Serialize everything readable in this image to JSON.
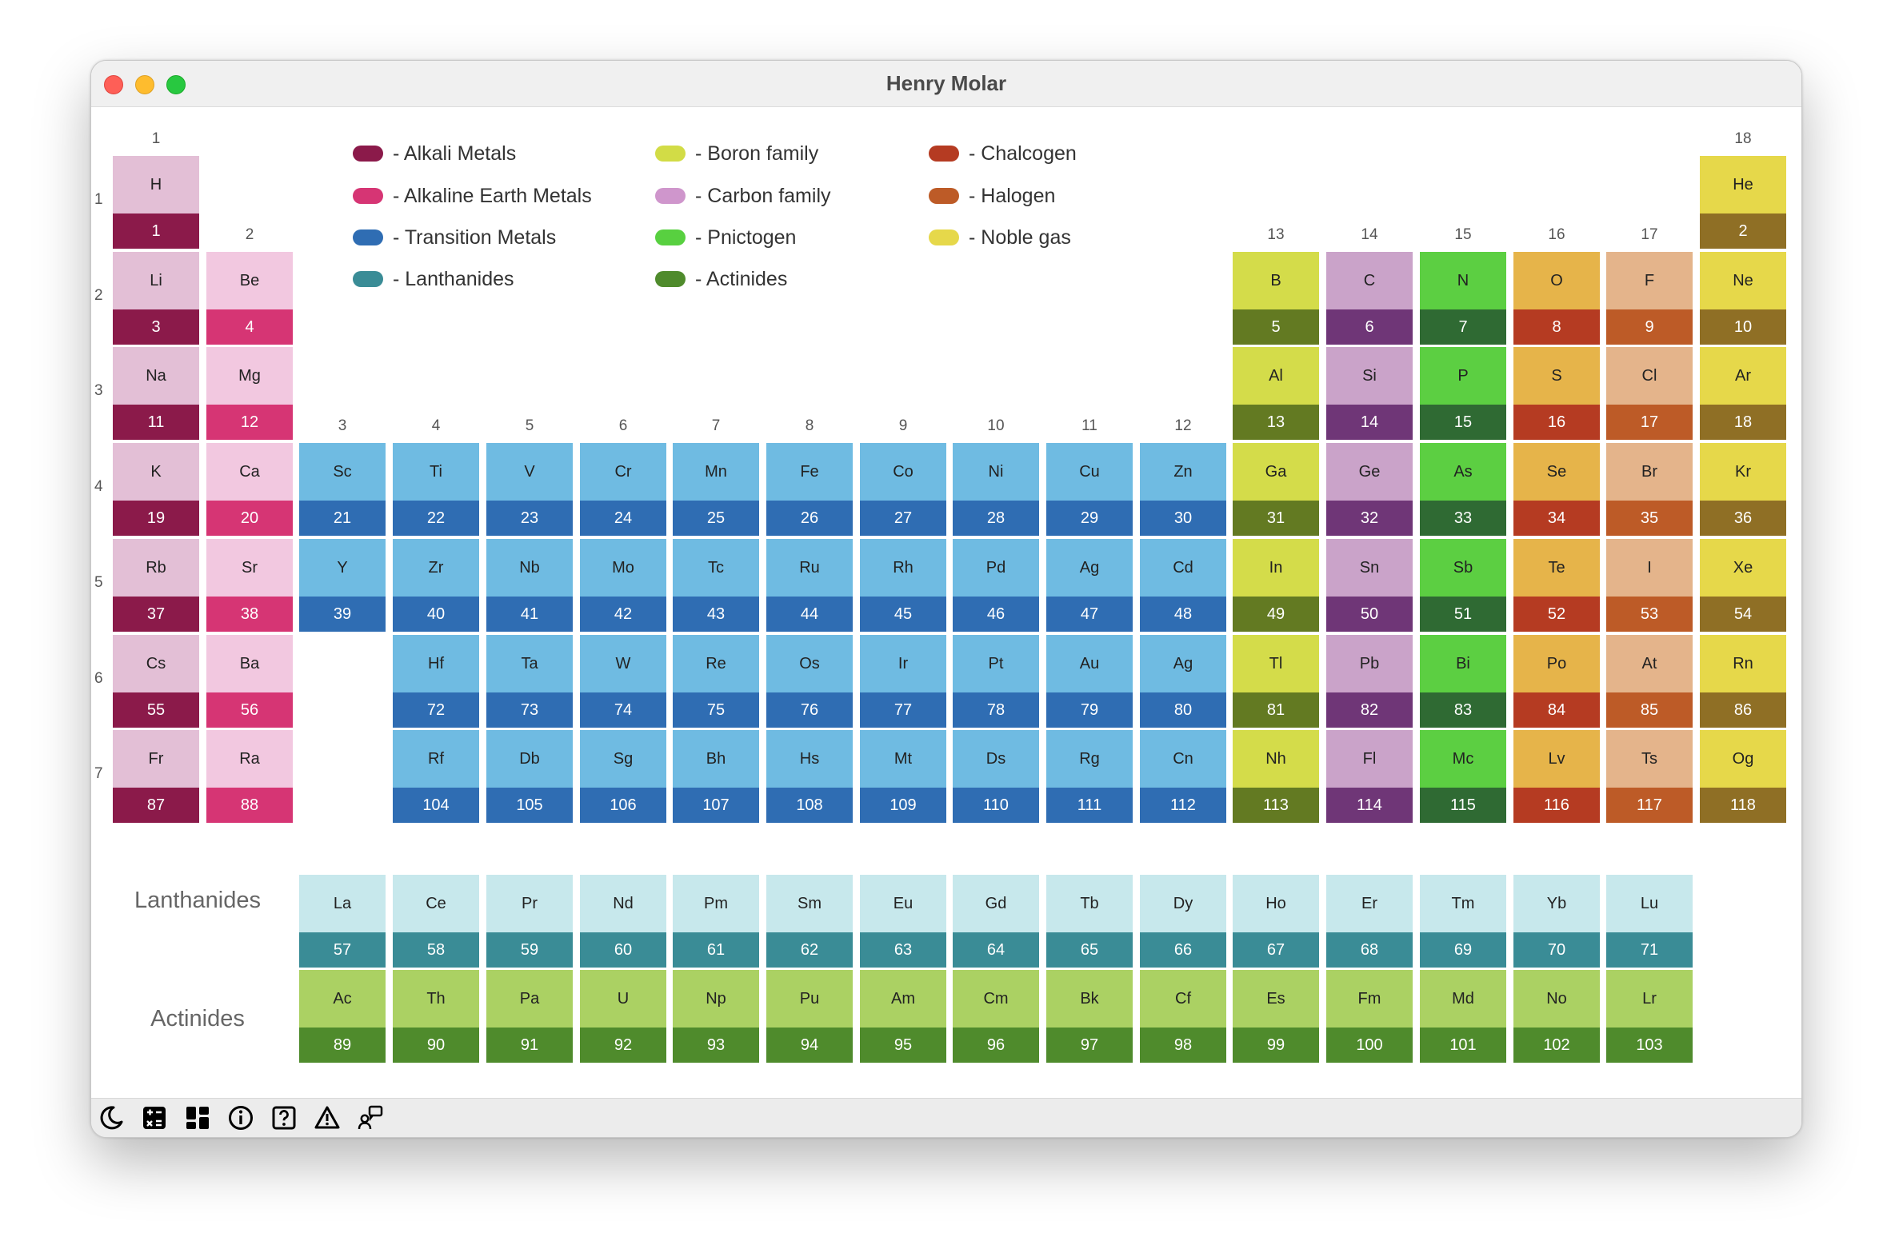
{
  "window": {
    "title": "Henry Molar"
  },
  "group_labels": [
    "1",
    "2",
    "3",
    "4",
    "5",
    "6",
    "7",
    "8",
    "9",
    "10",
    "11",
    "12",
    "13",
    "14",
    "15",
    "16",
    "17",
    "18"
  ],
  "period_labels": [
    "1",
    "2",
    "3",
    "4",
    "5",
    "6",
    "7"
  ],
  "series_labels": {
    "lanthanides": "Lanthanides",
    "actinides": "Actinides"
  },
  "legend": [
    {
      "key": "alkali",
      "label": "- Alkali Metals",
      "color": "#8b1a4a"
    },
    {
      "key": "alkaline",
      "label": "- Alkaline Earth Metals",
      "color": "#d63574"
    },
    {
      "key": "transition",
      "label": "- Transition Metals",
      "color": "#2f6db3"
    },
    {
      "key": "lanth",
      "label": "- Lanthanides",
      "color": "#3a8c96"
    },
    {
      "key": "boron",
      "label": "- Boron family",
      "color": "#d2dc46"
    },
    {
      "key": "carbon",
      "label": "- Carbon family",
      "color": "#cf96cc"
    },
    {
      "key": "pnictogen",
      "label": "- Pnictogen",
      "color": "#58d040"
    },
    {
      "key": "actin",
      "label": "- Actinides",
      "color": "#4f8b2c"
    },
    {
      "key": "chalcogen",
      "label": "- Chalcogen",
      "color": "#b53b22"
    },
    {
      "key": "halogen",
      "label": "- Halogen",
      "color": "#bd5b27"
    },
    {
      "key": "noble",
      "label": "- Noble gas",
      "color": "#e6d84a"
    }
  ],
  "categories": {
    "alkali": {
      "top": "#e3bfd6",
      "bottom": "#8b1a4a"
    },
    "alkaline": {
      "top": "#f2c8e0",
      "bottom": "#d63574"
    },
    "transition": {
      "top": "#6fbbe2",
      "bottom": "#2f6db3"
    },
    "boron": {
      "top": "#d4dc4a",
      "bottom": "#637a22"
    },
    "carbon": {
      "top": "#caa3c9",
      "bottom": "#6f3677"
    },
    "pnictogen": {
      "top": "#5ccf42",
      "bottom": "#2f6a33"
    },
    "chalcogen": {
      "top": "#e6b44a",
      "bottom": "#b53b22"
    },
    "halogen": {
      "top": "#e4b48b",
      "bottom": "#bd5b27"
    },
    "noble": {
      "top": "#e6d84a",
      "bottom": "#8f6f25"
    },
    "lanth": {
      "top": "#c7e8ec",
      "bottom": "#3a8c96"
    },
    "actin": {
      "top": "#abd163",
      "bottom": "#4f8b2c"
    }
  },
  "elements": [
    {
      "s": "H",
      "n": 1,
      "g": 1,
      "p": 1,
      "c": "alkali"
    },
    {
      "s": "He",
      "n": 2,
      "g": 18,
      "p": 1,
      "c": "noble"
    },
    {
      "s": "Li",
      "n": 3,
      "g": 1,
      "p": 2,
      "c": "alkali"
    },
    {
      "s": "Be",
      "n": 4,
      "g": 2,
      "p": 2,
      "c": "alkaline"
    },
    {
      "s": "B",
      "n": 5,
      "g": 13,
      "p": 2,
      "c": "boron"
    },
    {
      "s": "C",
      "n": 6,
      "g": 14,
      "p": 2,
      "c": "carbon"
    },
    {
      "s": "N",
      "n": 7,
      "g": 15,
      "p": 2,
      "c": "pnictogen"
    },
    {
      "s": "O",
      "n": 8,
      "g": 16,
      "p": 2,
      "c": "chalcogen"
    },
    {
      "s": "F",
      "n": 9,
      "g": 17,
      "p": 2,
      "c": "halogen"
    },
    {
      "s": "Ne",
      "n": 10,
      "g": 18,
      "p": 2,
      "c": "noble"
    },
    {
      "s": "Na",
      "n": 11,
      "g": 1,
      "p": 3,
      "c": "alkali"
    },
    {
      "s": "Mg",
      "n": 12,
      "g": 2,
      "p": 3,
      "c": "alkaline"
    },
    {
      "s": "Al",
      "n": 13,
      "g": 13,
      "p": 3,
      "c": "boron"
    },
    {
      "s": "Si",
      "n": 14,
      "g": 14,
      "p": 3,
      "c": "carbon"
    },
    {
      "s": "P",
      "n": 15,
      "g": 15,
      "p": 3,
      "c": "pnictogen"
    },
    {
      "s": "S",
      "n": 16,
      "g": 16,
      "p": 3,
      "c": "chalcogen"
    },
    {
      "s": "Cl",
      "n": 17,
      "g": 17,
      "p": 3,
      "c": "halogen"
    },
    {
      "s": "Ar",
      "n": 18,
      "g": 18,
      "p": 3,
      "c": "noble"
    },
    {
      "s": "K",
      "n": 19,
      "g": 1,
      "p": 4,
      "c": "alkali"
    },
    {
      "s": "Ca",
      "n": 20,
      "g": 2,
      "p": 4,
      "c": "alkaline"
    },
    {
      "s": "Sc",
      "n": 21,
      "g": 3,
      "p": 4,
      "c": "transition"
    },
    {
      "s": "Ti",
      "n": 22,
      "g": 4,
      "p": 4,
      "c": "transition"
    },
    {
      "s": "V",
      "n": 23,
      "g": 5,
      "p": 4,
      "c": "transition"
    },
    {
      "s": "Cr",
      "n": 24,
      "g": 6,
      "p": 4,
      "c": "transition"
    },
    {
      "s": "Mn",
      "n": 25,
      "g": 7,
      "p": 4,
      "c": "transition"
    },
    {
      "s": "Fe",
      "n": 26,
      "g": 8,
      "p": 4,
      "c": "transition"
    },
    {
      "s": "Co",
      "n": 27,
      "g": 9,
      "p": 4,
      "c": "transition"
    },
    {
      "s": "Ni",
      "n": 28,
      "g": 10,
      "p": 4,
      "c": "transition"
    },
    {
      "s": "Cu",
      "n": 29,
      "g": 11,
      "p": 4,
      "c": "transition"
    },
    {
      "s": "Zn",
      "n": 30,
      "g": 12,
      "p": 4,
      "c": "transition"
    },
    {
      "s": "Ga",
      "n": 31,
      "g": 13,
      "p": 4,
      "c": "boron"
    },
    {
      "s": "Ge",
      "n": 32,
      "g": 14,
      "p": 4,
      "c": "carbon"
    },
    {
      "s": "As",
      "n": 33,
      "g": 15,
      "p": 4,
      "c": "pnictogen"
    },
    {
      "s": "Se",
      "n": 34,
      "g": 16,
      "p": 4,
      "c": "chalcogen"
    },
    {
      "s": "Br",
      "n": 35,
      "g": 17,
      "p": 4,
      "c": "halogen"
    },
    {
      "s": "Kr",
      "n": 36,
      "g": 18,
      "p": 4,
      "c": "noble"
    },
    {
      "s": "Rb",
      "n": 37,
      "g": 1,
      "p": 5,
      "c": "alkali"
    },
    {
      "s": "Sr",
      "n": 38,
      "g": 2,
      "p": 5,
      "c": "alkaline"
    },
    {
      "s": "Y",
      "n": 39,
      "g": 3,
      "p": 5,
      "c": "transition"
    },
    {
      "s": "Zr",
      "n": 40,
      "g": 4,
      "p": 5,
      "c": "transition"
    },
    {
      "s": "Nb",
      "n": 41,
      "g": 5,
      "p": 5,
      "c": "transition"
    },
    {
      "s": "Mo",
      "n": 42,
      "g": 6,
      "p": 5,
      "c": "transition"
    },
    {
      "s": "Tc",
      "n": 43,
      "g": 7,
      "p": 5,
      "c": "transition"
    },
    {
      "s": "Ru",
      "n": 44,
      "g": 8,
      "p": 5,
      "c": "transition"
    },
    {
      "s": "Rh",
      "n": 45,
      "g": 9,
      "p": 5,
      "c": "transition"
    },
    {
      "s": "Pd",
      "n": 46,
      "g": 10,
      "p": 5,
      "c": "transition"
    },
    {
      "s": "Ag",
      "n": 47,
      "g": 11,
      "p": 5,
      "c": "transition"
    },
    {
      "s": "Cd",
      "n": 48,
      "g": 12,
      "p": 5,
      "c": "transition"
    },
    {
      "s": "In",
      "n": 49,
      "g": 13,
      "p": 5,
      "c": "boron"
    },
    {
      "s": "Sn",
      "n": 50,
      "g": 14,
      "p": 5,
      "c": "carbon"
    },
    {
      "s": "Sb",
      "n": 51,
      "g": 15,
      "p": 5,
      "c": "pnictogen"
    },
    {
      "s": "Te",
      "n": 52,
      "g": 16,
      "p": 5,
      "c": "chalcogen"
    },
    {
      "s": "I",
      "n": 53,
      "g": 17,
      "p": 5,
      "c": "halogen"
    },
    {
      "s": "Xe",
      "n": 54,
      "g": 18,
      "p": 5,
      "c": "noble"
    },
    {
      "s": "Cs",
      "n": 55,
      "g": 1,
      "p": 6,
      "c": "alkali"
    },
    {
      "s": "Ba",
      "n": 56,
      "g": 2,
      "p": 6,
      "c": "alkaline"
    },
    {
      "s": "Hf",
      "n": 72,
      "g": 4,
      "p": 6,
      "c": "transition"
    },
    {
      "s": "Ta",
      "n": 73,
      "g": 5,
      "p": 6,
      "c": "transition"
    },
    {
      "s": "W",
      "n": 74,
      "g": 6,
      "p": 6,
      "c": "transition"
    },
    {
      "s": "Re",
      "n": 75,
      "g": 7,
      "p": 6,
      "c": "transition"
    },
    {
      "s": "Os",
      "n": 76,
      "g": 8,
      "p": 6,
      "c": "transition"
    },
    {
      "s": "Ir",
      "n": 77,
      "g": 9,
      "p": 6,
      "c": "transition"
    },
    {
      "s": "Pt",
      "n": 78,
      "g": 10,
      "p": 6,
      "c": "transition"
    },
    {
      "s": "Au",
      "n": 79,
      "g": 11,
      "p": 6,
      "c": "transition"
    },
    {
      "s": "Ag",
      "n": 80,
      "g": 12,
      "p": 6,
      "c": "transition"
    },
    {
      "s": "Tl",
      "n": 81,
      "g": 13,
      "p": 6,
      "c": "boron"
    },
    {
      "s": "Pb",
      "n": 82,
      "g": 14,
      "p": 6,
      "c": "carbon"
    },
    {
      "s": "Bi",
      "n": 83,
      "g": 15,
      "p": 6,
      "c": "pnictogen"
    },
    {
      "s": "Po",
      "n": 84,
      "g": 16,
      "p": 6,
      "c": "chalcogen"
    },
    {
      "s": "At",
      "n": 85,
      "g": 17,
      "p": 6,
      "c": "halogen"
    },
    {
      "s": "Rn",
      "n": 86,
      "g": 18,
      "p": 6,
      "c": "noble"
    },
    {
      "s": "Fr",
      "n": 87,
      "g": 1,
      "p": 7,
      "c": "alkali"
    },
    {
      "s": "Ra",
      "n": 88,
      "g": 2,
      "p": 7,
      "c": "alkaline"
    },
    {
      "s": "Rf",
      "n": 104,
      "g": 4,
      "p": 7,
      "c": "transition"
    },
    {
      "s": "Db",
      "n": 105,
      "g": 5,
      "p": 7,
      "c": "transition"
    },
    {
      "s": "Sg",
      "n": 106,
      "g": 6,
      "p": 7,
      "c": "transition"
    },
    {
      "s": "Bh",
      "n": 107,
      "g": 7,
      "p": 7,
      "c": "transition"
    },
    {
      "s": "Hs",
      "n": 108,
      "g": 8,
      "p": 7,
      "c": "transition"
    },
    {
      "s": "Mt",
      "n": 109,
      "g": 9,
      "p": 7,
      "c": "transition"
    },
    {
      "s": "Ds",
      "n": 110,
      "g": 10,
      "p": 7,
      "c": "transition"
    },
    {
      "s": "Rg",
      "n": 111,
      "g": 11,
      "p": 7,
      "c": "transition"
    },
    {
      "s": "Cn",
      "n": 112,
      "g": 12,
      "p": 7,
      "c": "transition"
    },
    {
      "s": "Nh",
      "n": 113,
      "g": 13,
      "p": 7,
      "c": "boron"
    },
    {
      "s": "Fl",
      "n": 114,
      "g": 14,
      "p": 7,
      "c": "carbon"
    },
    {
      "s": "Mc",
      "n": 115,
      "g": 15,
      "p": 7,
      "c": "pnictogen"
    },
    {
      "s": "Lv",
      "n": 116,
      "g": 16,
      "p": 7,
      "c": "chalcogen"
    },
    {
      "s": "Ts",
      "n": 117,
      "g": 17,
      "p": 7,
      "c": "halogen"
    },
    {
      "s": "Og",
      "n": 118,
      "g": 18,
      "p": 7,
      "c": "noble"
    }
  ],
  "lanthanides": [
    {
      "s": "La",
      "n": 57
    },
    {
      "s": "Ce",
      "n": 58
    },
    {
      "s": "Pr",
      "n": 59
    },
    {
      "s": "Nd",
      "n": 60
    },
    {
      "s": "Pm",
      "n": 61
    },
    {
      "s": "Sm",
      "n": 62
    },
    {
      "s": "Eu",
      "n": 63
    },
    {
      "s": "Gd",
      "n": 64
    },
    {
      "s": "Tb",
      "n": 65
    },
    {
      "s": "Dy",
      "n": 66
    },
    {
      "s": "Ho",
      "n": 67
    },
    {
      "s": "Er",
      "n": 68
    },
    {
      "s": "Tm",
      "n": 69
    },
    {
      "s": "Yb",
      "n": 70
    },
    {
      "s": "Lu",
      "n": 71
    }
  ],
  "actinides": [
    {
      "s": "Ac",
      "n": 89
    },
    {
      "s": "Th",
      "n": 90
    },
    {
      "s": "Pa",
      "n": 91
    },
    {
      "s": "U",
      "n": 92
    },
    {
      "s": "Np",
      "n": 93
    },
    {
      "s": "Pu",
      "n": 94
    },
    {
      "s": "Am",
      "n": 95
    },
    {
      "s": "Cm",
      "n": 96
    },
    {
      "s": "Bk",
      "n": 97
    },
    {
      "s": "Cf",
      "n": 98
    },
    {
      "s": "Es",
      "n": 99
    },
    {
      "s": "Fm",
      "n": 100
    },
    {
      "s": "Md",
      "n": 101
    },
    {
      "s": "No",
      "n": 102
    },
    {
      "s": "Lr",
      "n": 103
    }
  ],
  "statusbar_icons": [
    "moon-icon",
    "calculator-icon",
    "dashboard-icon",
    "info-icon",
    "help-icon",
    "warning-icon",
    "feedback-icon"
  ]
}
